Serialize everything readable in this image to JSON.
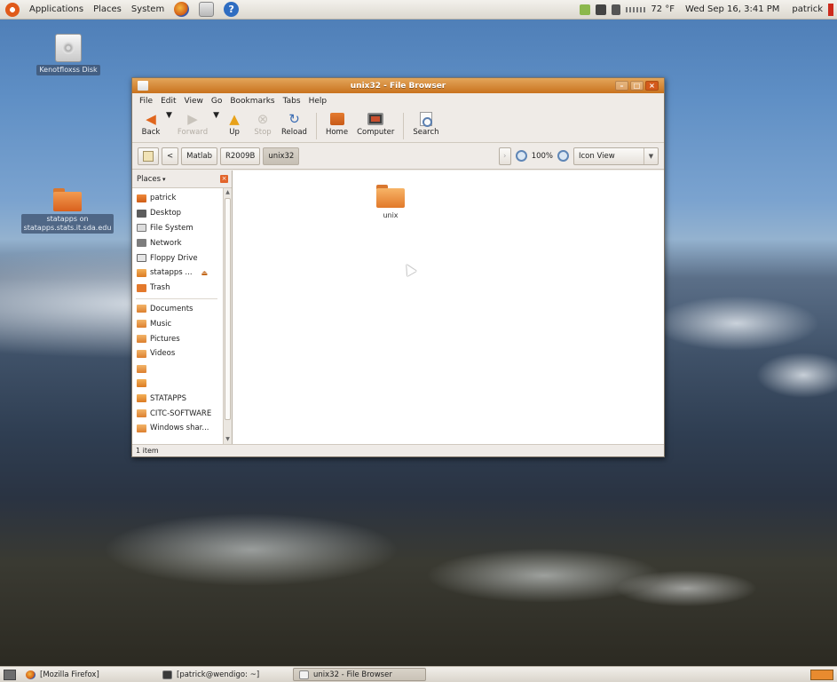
{
  "top_panel": {
    "menus": [
      "Applications",
      "Places",
      "System"
    ],
    "temperature": "72 °F",
    "clock": "Wed Sep 16,  3:41 PM",
    "user": "patrick"
  },
  "desktop_icons": [
    {
      "label": "Kenotfloxss Disk"
    },
    {
      "label": "statapps on\nstatapps.stats.it.sda.edu"
    }
  ],
  "window": {
    "title": "unix32 - File Browser",
    "menu": [
      "File",
      "Edit",
      "View",
      "Go",
      "Bookmarks",
      "Tabs",
      "Help"
    ],
    "toolbar": {
      "back": "Back",
      "forward": "Forward",
      "up": "Up",
      "stop": "Stop",
      "reload": "Reload",
      "home": "Home",
      "computer": "Computer",
      "search": "Search"
    },
    "location": {
      "crumbs": [
        "Matlab",
        "R2009B",
        "unix32"
      ],
      "active_crumb": "unix32",
      "zoom": "100%",
      "view_mode": "Icon View"
    },
    "sidebar": {
      "header": "Places",
      "places": [
        {
          "label": "patrick",
          "icon": "home"
        },
        {
          "label": "Desktop",
          "icon": "desktop"
        },
        {
          "label": "File System",
          "icon": "fs"
        },
        {
          "label": "Network",
          "icon": "network"
        },
        {
          "label": "Floppy Drive",
          "icon": "floppy"
        },
        {
          "label": "statapps ...",
          "icon": "drive"
        },
        {
          "label": "Trash",
          "icon": "trash"
        }
      ],
      "bookmarks": [
        {
          "label": "Documents"
        },
        {
          "label": "Music"
        },
        {
          "label": "Pictures"
        },
        {
          "label": "Videos"
        },
        {
          "label": ""
        },
        {
          "label": ""
        },
        {
          "label": "STATAPPS"
        },
        {
          "label": "CITC-SOFTWARE"
        },
        {
          "label": "Windows shar..."
        }
      ]
    },
    "files": [
      {
        "name": "unix"
      }
    ],
    "status": "1 item"
  },
  "taskbar": {
    "tasks": [
      {
        "label": "[Mozilla Firefox]",
        "icon": "firefox",
        "active": false
      },
      {
        "label": "[patrick@wendigo: ~]",
        "icon": "terminal",
        "active": false
      },
      {
        "label": "unix32 - File Browser",
        "icon": "files",
        "active": true
      }
    ]
  }
}
